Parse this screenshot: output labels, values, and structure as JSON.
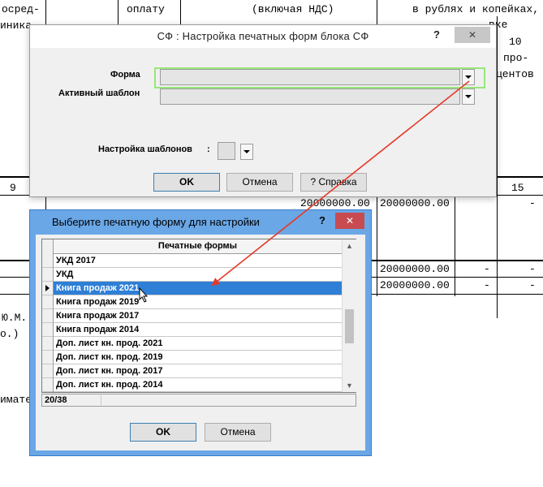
{
  "background_document": {
    "header_texts": [
      "осред-",
      "оплату",
      "(включая НДС)",
      "в рублях и копейках,",
      "вке",
      "иника",
      "10",
      "про-",
      "центов"
    ],
    "row_numbers": [
      "9",
      "15"
    ],
    "amounts": [
      "20000000.00",
      "20000000.00",
      "20000000.00",
      "20000000.00"
    ],
    "dashes": [
      "-",
      "-",
      "-",
      "-",
      "-"
    ],
    "side_texts": [
      "Ю.М.",
      "о.)",
      "имате"
    ]
  },
  "settings_dialog": {
    "title": "СФ : Настройка печатных форм блока СФ",
    "help_label": "?",
    "close_label": "✕",
    "forma_label": "Форма",
    "active_template_label": "Активный шаблон",
    "templates_setup_label": "Настройка шаблонов",
    "colon": ":",
    "forma_value": "",
    "active_template_value": "",
    "ok_label": "OK",
    "cancel_label": "Отмена",
    "help_button_label": "? Справка"
  },
  "select_dialog": {
    "title": "Выберите печатную форму для настройки",
    "help_label": "?",
    "close_label": "✕",
    "column_header": "Печатные формы",
    "rows": [
      "УКД 2017",
      "УКД",
      "Книга продаж 2021",
      "Книга продаж 2019",
      "Книга продаж 2017",
      "Книга продаж 2014",
      "Доп. лист кн. прод. 2021",
      "Доп. лист кн. прод. 2019",
      "Доп. лист кн. прод. 2017",
      "Доп. лист кн. прод. 2014"
    ],
    "selected_index": 2,
    "status": "20/38",
    "ok_label": "OK",
    "cancel_label": "Отмена"
  },
  "icons": {
    "dropdown": "chevron-down-icon",
    "row_pointer": "row-pointer-icon",
    "mouse_cursor": "mouse-pointer-icon",
    "annotation_arrow": "red-arrow-annotation"
  },
  "colors": {
    "selection": "#2f7fd6",
    "highlight_box": "#98e67a",
    "arrow": "#e53a2a",
    "dialog_frame_active": "#6aa7e6",
    "close_active": "#c74b50"
  }
}
